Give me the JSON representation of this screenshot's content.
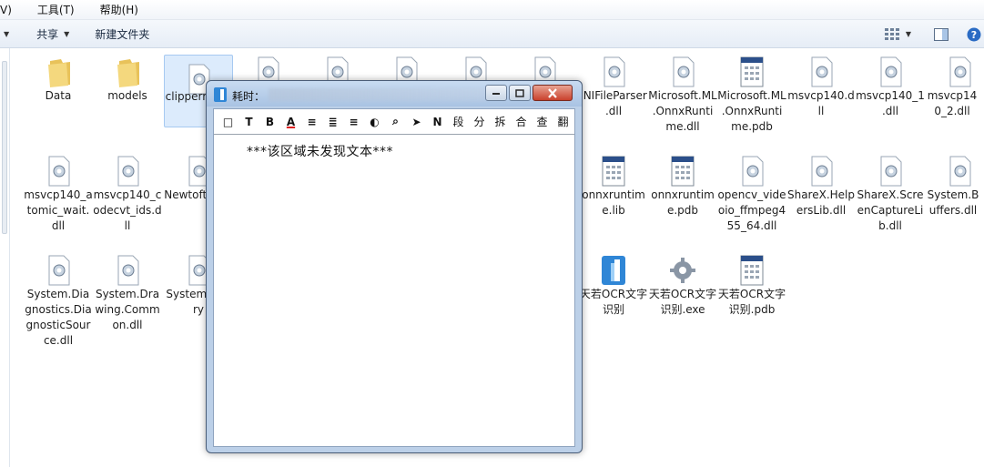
{
  "menubar": {
    "items": [
      "V)",
      "工具(T)",
      "帮助(H)"
    ]
  },
  "toolbar": {
    "share_label": "共享",
    "new_folder_label": "新建文件夹"
  },
  "files": [
    {
      "name": "Data",
      "type": "folder"
    },
    {
      "name": "models",
      "type": "folder"
    },
    {
      "name": "clipperrary.d",
      "type": "dll"
    },
    {
      "name": "",
      "type": "dll"
    },
    {
      "name": "",
      "type": "dll"
    },
    {
      "name": "",
      "type": "dll"
    },
    {
      "name": "",
      "type": "dll"
    },
    {
      "name": "",
      "type": "dll"
    },
    {
      "name": "INIFileParser.dll",
      "type": "dll"
    },
    {
      "name": "Microsoft.ML.OnnxRuntime.dll",
      "type": "dll"
    },
    {
      "name": "Microsoft.ML.OnnxRuntime.pdb",
      "type": "pdb"
    },
    {
      "name": "msvcp140.dll",
      "type": "dll"
    },
    {
      "name": "msvcp140_1.dll",
      "type": "dll"
    },
    {
      "name": "msvcp140_2.dll",
      "type": "dll"
    },
    {
      "name": "msvcp140_atomic_wait.dll",
      "type": "dll"
    },
    {
      "name": "msvcp140_codecvt_ids.dll",
      "type": "dll"
    },
    {
      "name": "Newtoft.Json",
      "type": "dll"
    },
    {
      "name": "onnxruntime.lib",
      "type": "pdb"
    },
    {
      "name": "onnxruntime.pdb",
      "type": "pdb"
    },
    {
      "name": "opencv_videoio_ffmpeg455_64.dll",
      "type": "dll"
    },
    {
      "name": "ShareX.HelpersLib.dll",
      "type": "dll"
    },
    {
      "name": "ShareX.ScreenCaptureLib.dll",
      "type": "dll"
    },
    {
      "name": "System.Buffers.dll",
      "type": "dll"
    },
    {
      "name": "System.Diagnostics.DiagnosticSource.dll",
      "type": "dll"
    },
    {
      "name": "System.Drawing.Common.dll",
      "type": "dll"
    },
    {
      "name": "Systememory",
      "type": "dll"
    },
    {
      "name": "天若OCR文字识别",
      "type": "app"
    },
    {
      "name": "天若OCR文字识别.exe",
      "type": "exe"
    },
    {
      "name": "天若OCR文字识别.pdb",
      "type": "pdb"
    }
  ],
  "ocr_window": {
    "title": "耗时：",
    "tools": [
      "□",
      "T",
      "B",
      "A",
      "≡",
      "≣",
      "≡",
      "◐",
      "⌕",
      "➤",
      "N",
      "段",
      "分",
      "拆",
      "合",
      "查",
      "翻"
    ],
    "content": "***该区域未发现文本***"
  }
}
